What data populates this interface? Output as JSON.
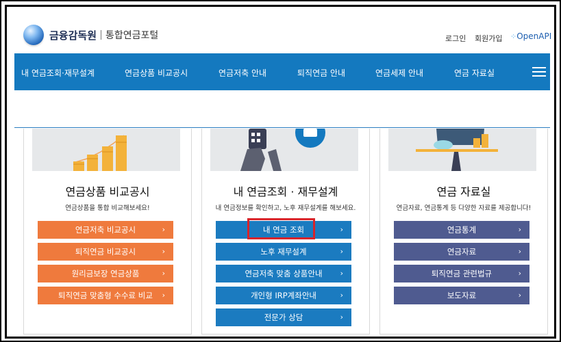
{
  "header": {
    "org_name": "금융감독원",
    "portal_name": "통합연금포털",
    "login": "로그인",
    "join": "회원가입",
    "openapi": "OpenAPI"
  },
  "nav": {
    "items": [
      "내 연금조회·재무설계",
      "연금상품 비교공시",
      "연금저축 안내",
      "퇴직연금 안내",
      "연금세제 안내",
      "연금 자료실"
    ]
  },
  "cards": [
    {
      "title": "연금상품 비교공시",
      "desc": "연금상품을 통합 비교해보세요!",
      "buttons": [
        "연금저축 비교공시",
        "퇴직연금 비교공시",
        "원리금보장 연금상품",
        "퇴직연금 맞춤형 수수료 비교"
      ],
      "color": "#ef7a3d"
    },
    {
      "title": "내 연금조회 · 재무설계",
      "desc": "내 연금정보를 확인하고, 노후 재무설계를 해보세요.",
      "buttons": [
        "내 연금 조회",
        "노후 재무설계",
        "연금저축 맞춤 상품안내",
        "개인형 IRP계좌안내",
        "전문가 상담"
      ],
      "color": "#1b7bc0"
    },
    {
      "title": "연금 자료실",
      "desc": "연금자료, 연금통계 등 다양한 자료를 제공합니다!",
      "buttons": [
        "연금통계",
        "연금자료",
        "퇴직연금 관련법규",
        "보도자료"
      ],
      "color": "#4f5b90"
    }
  ],
  "icons": {
    "chevron": "›"
  }
}
